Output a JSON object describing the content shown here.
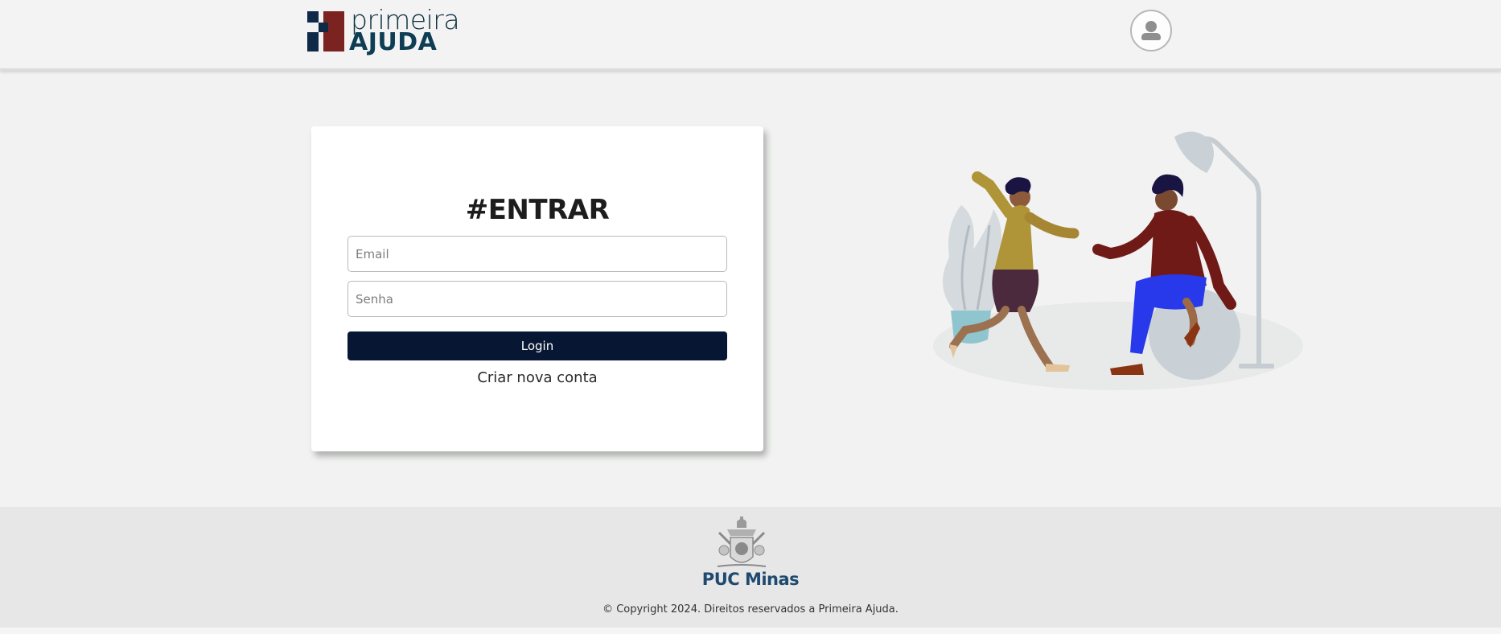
{
  "header": {
    "logo": {
      "line1": "primeira",
      "line2": "AJUDA",
      "mark_color_dark": "#0f2a47",
      "mark_color_red": "#7a2321"
    },
    "user_icon": "user-avatar-icon"
  },
  "login": {
    "title": "#ENTRAR",
    "email_placeholder": "Email",
    "password_placeholder": "Senha",
    "login_button": "Login",
    "create_account_link": "Criar nova conta"
  },
  "illustration": {
    "icon": "people-greeting-illustration"
  },
  "footer": {
    "institution": "PUC Minas",
    "copyright": "© Copyright 2024. Direitos reservados a Primeira Ajuda."
  },
  "colors": {
    "primary_button": "#071733",
    "background": "#f1f2f1",
    "footer_bg": "#e7e7e7"
  }
}
